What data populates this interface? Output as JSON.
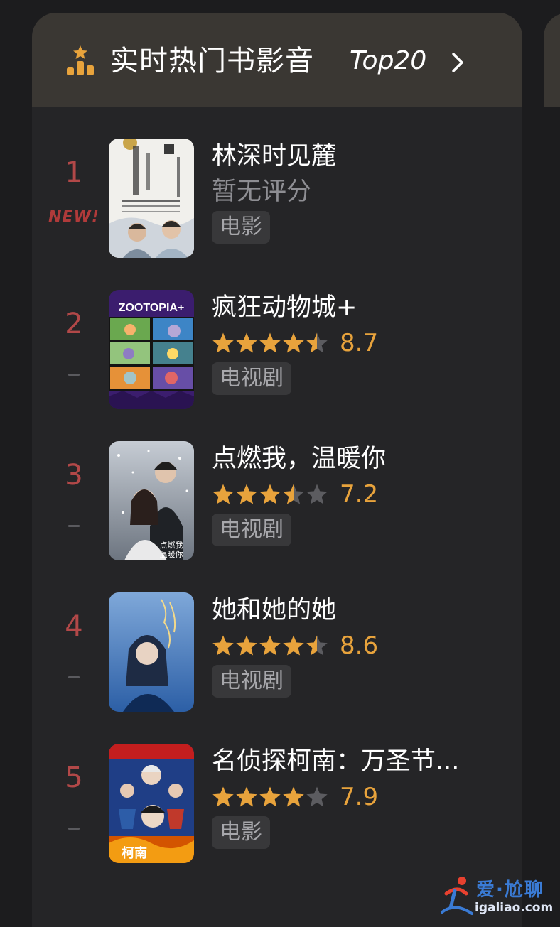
{
  "header": {
    "title": "实时热门书影音",
    "top_label": "Top20",
    "icon": "podium-icon",
    "chevron_icon": "chevron-right-icon",
    "accent_color": "#e8a33c"
  },
  "items": [
    {
      "rank": "1",
      "rank_change": "NEW!",
      "title": "林深时见麓",
      "no_score_text": "暂无评分",
      "rating": null,
      "score": "",
      "tag": "电影",
      "poster_icon": "poster-image"
    },
    {
      "rank": "2",
      "rank_change": "",
      "title": "疯狂动物城+",
      "rating": 4.5,
      "score": "8.7",
      "tag": "电视剧",
      "poster_icon": "poster-image",
      "poster_text": "ZOOTOPIA+"
    },
    {
      "rank": "3",
      "rank_change": "",
      "title": "点燃我，温暖你",
      "rating": 3.5,
      "score": "7.2",
      "tag": "电视剧",
      "poster_icon": "poster-image"
    },
    {
      "rank": "4",
      "rank_change": "",
      "title": "她和她的她",
      "rating": 4.5,
      "score": "8.6",
      "tag": "电视剧",
      "poster_icon": "poster-image"
    },
    {
      "rank": "5",
      "rank_change": "",
      "title": "名侦探柯南：万圣节...",
      "rating": 4,
      "score": "7.9",
      "tag": "电影",
      "poster_icon": "poster-image"
    }
  ],
  "colors": {
    "rank": "#b24848",
    "star_filled": "#e8a33c",
    "star_empty": "#5c5c60",
    "score": "#e8a33c"
  },
  "watermark": {
    "text": "爱·尬聊",
    "url": "igaliao.com"
  }
}
